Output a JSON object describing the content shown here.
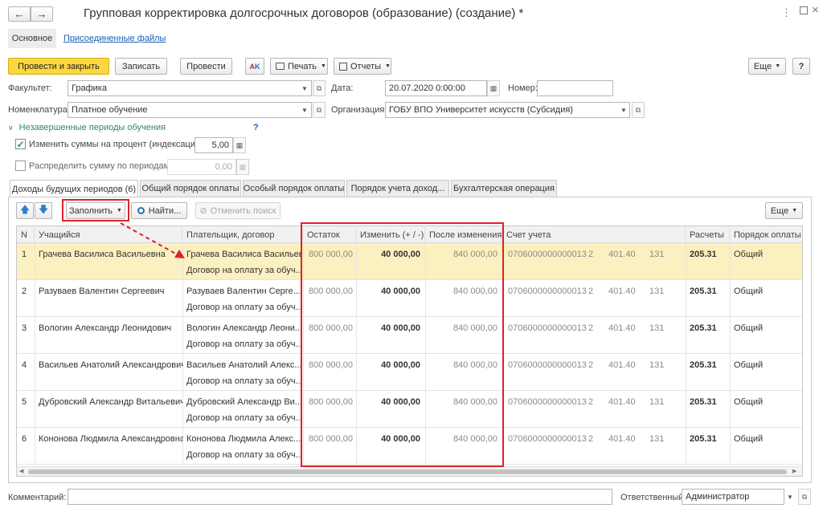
{
  "window": {
    "title": "Групповая корректировка долгосрочных договоров (образование) (создание) *"
  },
  "nav": {
    "main": "Основное",
    "files": "Присоединенные файлы"
  },
  "toolbar": {
    "post_close": "Провести и закрыть",
    "save": "Записать",
    "post": "Провести",
    "print": "Печать",
    "reports": "Отчеты",
    "more": "Еще",
    "help": "?"
  },
  "form": {
    "faculty_label": "Факультет:",
    "faculty_value": "Графика",
    "date_label": "Дата:",
    "date_value": "20.07.2020  0:00:00",
    "number_label": "Номер:",
    "number_value": "",
    "nomenclature_label": "Номенклатура:",
    "nomenclature_value": "Платное обучение",
    "org_label": "Организация:",
    "org_value": "ГОБУ ВПО Университет искусств (Субсидия)",
    "periods_group": "Незавершенные периоды обучения",
    "periods_help": "?",
    "change_percent_label": "Изменить суммы на процент (индексация)",
    "change_percent_value": "5,00",
    "change_percent_checked": true,
    "distribute_label": "Распределить сумму по периодам",
    "distribute_value": "0,00",
    "distribute_checked": false
  },
  "tabs": [
    "Доходы будущих периодов (6)",
    "Общий порядок оплаты",
    "Особый порядок оплаты",
    "Порядок учета доход...",
    "Бухгалтерская операция"
  ],
  "table_toolbar": {
    "fill": "Заполнить",
    "find": "Найти...",
    "cancel_search": "Отменить поиск",
    "more": "Еще"
  },
  "table": {
    "columns": [
      "N",
      "Учащийся",
      "Плательщик, договор",
      "Остаток",
      "Изменить (+ / -)",
      "После изменения",
      "Счет учета",
      "Расчеты",
      "Порядок оплаты"
    ],
    "rows": [
      {
        "n": "1",
        "student": "Грачева Василиса Васильевна",
        "payer": "Грачева Василиса Васильевна",
        "contract": "Договор на оплату за обуч...",
        "balance": "800 000,00",
        "change": "40 000,00",
        "after": "840 000,00",
        "account": "0706000000000013",
        "c1": "2",
        "c2": "401.40",
        "c3": "131",
        "settle": "205.31",
        "order": "Общий"
      },
      {
        "n": "2",
        "student": "Разуваев Валентин Сергеевич",
        "payer": "Разуваев Валентин Серге...",
        "contract": "Договор на оплату за обуч...",
        "balance": "800 000,00",
        "change": "40 000,00",
        "after": "840 000,00",
        "account": "0706000000000013",
        "c1": "2",
        "c2": "401.40",
        "c3": "131",
        "settle": "205.31",
        "order": "Общий"
      },
      {
        "n": "3",
        "student": "Вологин Александр Леонидович",
        "payer": "Вологин Александр Леони...",
        "contract": "Договор на оплату за обуч...",
        "balance": "800 000,00",
        "change": "40 000,00",
        "after": "840 000,00",
        "account": "0706000000000013",
        "c1": "2",
        "c2": "401.40",
        "c3": "131",
        "settle": "205.31",
        "order": "Общий"
      },
      {
        "n": "4",
        "student": "Васильев Анатолий Александрович",
        "payer": "Васильев Анатолий Алекс...",
        "contract": "Договор на оплату за обуч...",
        "balance": "800 000,00",
        "change": "40 000,00",
        "after": "840 000,00",
        "account": "0706000000000013",
        "c1": "2",
        "c2": "401.40",
        "c3": "131",
        "settle": "205.31",
        "order": "Общий"
      },
      {
        "n": "5",
        "student": "Дубровский Александр Витальевич",
        "payer": "Дубровский Александр Ви...",
        "contract": "Договор на оплату за обуч...",
        "balance": "800 000,00",
        "change": "40 000,00",
        "after": "840 000,00",
        "account": "0706000000000013",
        "c1": "2",
        "c2": "401.40",
        "c3": "131",
        "settle": "205.31",
        "order": "Общий"
      },
      {
        "n": "6",
        "student": "Кононова Людмила Александровна",
        "payer": "Кононова Людмила Алекс...",
        "contract": "Договор на оплату за обуч...",
        "balance": "800 000,00",
        "change": "40 000,00",
        "after": "840 000,00",
        "account": "0706000000000013",
        "c1": "2",
        "c2": "401.40",
        "c3": "131",
        "settle": "205.31",
        "order": "Общий"
      }
    ]
  },
  "footer": {
    "comment_label": "Комментарий:",
    "comment_value": "",
    "responsible_label": "Ответственный:",
    "responsible_value": "Администратор"
  },
  "colors": {
    "accent_yellow": "#fbd740",
    "selected_row": "#fbf0bf",
    "highlight_red": "#e0202a",
    "link_blue": "#1a5fb4",
    "group_green": "#2e8b57"
  }
}
